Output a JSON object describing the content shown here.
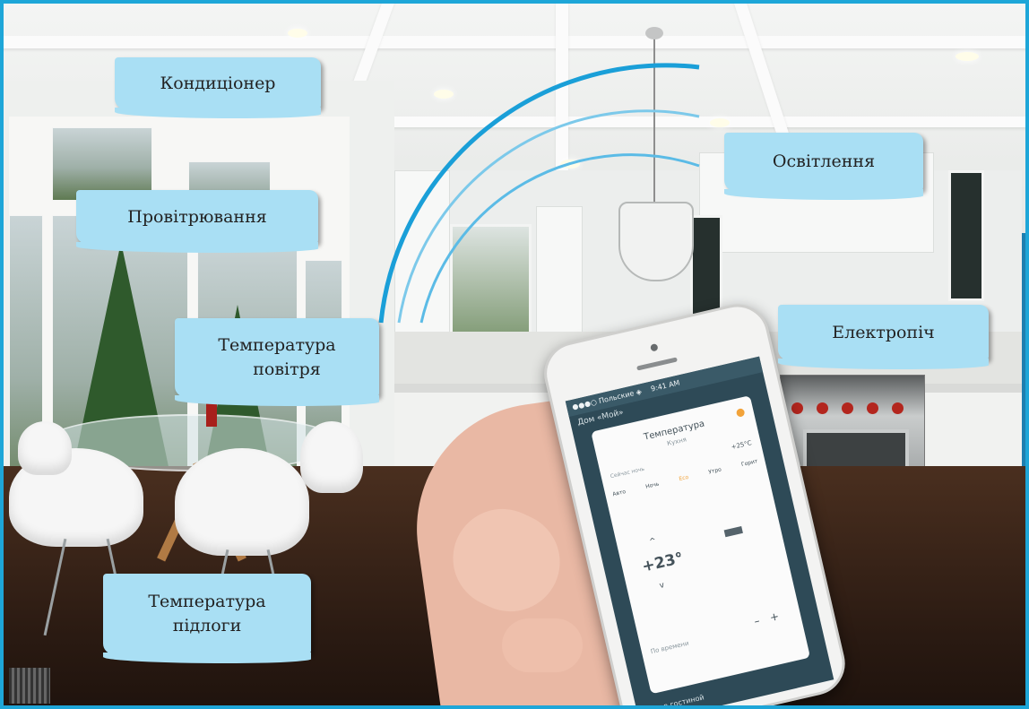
{
  "labels": {
    "air_conditioner": "Кондиціонер",
    "ventilation": "Провітрювання",
    "air_temperature_line1": "Температура",
    "air_temperature_line2": "повітря",
    "floor_temperature_line1": "Температура",
    "floor_temperature_line2": "підлоги",
    "lighting": "Освітлення",
    "electric_oven": "Електропіч"
  },
  "phone_app": {
    "carrier": "●●●○ Польские ◈",
    "time": "9:41 AM",
    "header_title": "Дом «Мой»",
    "card_title": "Температура",
    "card_subtitle": "Кухня",
    "current_line": "Сейчас ночь",
    "current_value": "+25°C",
    "modes": [
      "Авто",
      "Ночь",
      "Eco",
      "Утро",
      "Горит"
    ],
    "setpoint": "+23°",
    "unit": "C",
    "schedule_label": "По времени",
    "minus": "–",
    "plus": "+",
    "footer_item": "Свет в гостиной"
  },
  "colors": {
    "label_bg": "#a9dff4",
    "frame_border": "#1ea6d8",
    "accent_orange": "#f2a33a"
  }
}
